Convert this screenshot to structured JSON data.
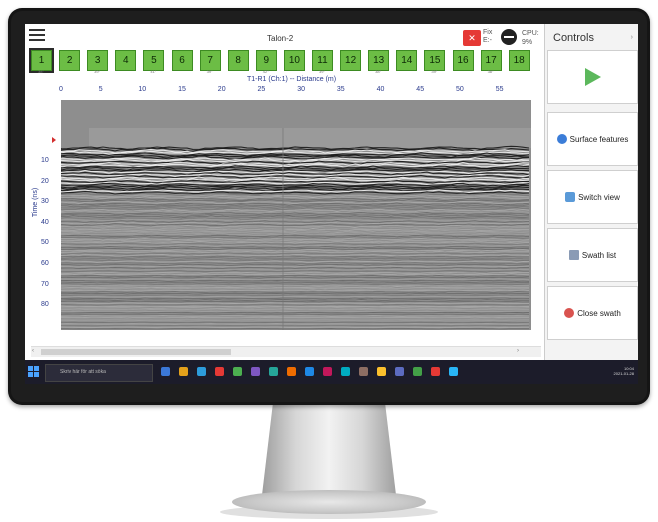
{
  "app": {
    "title": "Talon-2",
    "gps_text_line1": "Fix",
    "gps_text_line2": "E:-",
    "cpu_label": "CPU:",
    "cpu_value": "9%"
  },
  "channels": [
    {
      "num": "1",
      "sub": "38°",
      "selected": true
    },
    {
      "num": "2",
      "sub": ""
    },
    {
      "num": "3",
      "sub": "39°"
    },
    {
      "num": "4",
      "sub": ""
    },
    {
      "num": "5",
      "sub": "41°"
    },
    {
      "num": "6",
      "sub": ""
    },
    {
      "num": "7",
      "sub": "39°"
    },
    {
      "num": "8",
      "sub": ""
    },
    {
      "num": "9",
      "sub": "42°"
    },
    {
      "num": "10",
      "sub": ""
    },
    {
      "num": "11",
      "sub": "39°"
    },
    {
      "num": "12",
      "sub": ""
    },
    {
      "num": "13",
      "sub": "38°"
    },
    {
      "num": "14",
      "sub": ""
    },
    {
      "num": "15",
      "sub": "39°"
    },
    {
      "num": "16",
      "sub": ""
    },
    {
      "num": "17",
      "sub": "38°"
    },
    {
      "num": "18",
      "sub": ""
    }
  ],
  "chart": {
    "x_title": "T1-R1 (Ch:1) -- Distance (m)",
    "x_ticks": [
      "0",
      "5",
      "10",
      "15",
      "20",
      "25",
      "30",
      "35",
      "40",
      "45",
      "50",
      "55"
    ],
    "y_label": "Time (ns)",
    "y_ticks": [
      "10",
      "20",
      "30",
      "40",
      "50",
      "60",
      "70",
      "80"
    ]
  },
  "controls": {
    "title": "Controls",
    "collapse_arrow": "›",
    "buttons": [
      {
        "label": "",
        "icon": "play-icon"
      },
      {
        "label": "Surface features",
        "icon": "surface-icon"
      },
      {
        "label": "Switch view",
        "icon": "switch-view-icon"
      },
      {
        "label": "Swath list",
        "icon": "list-icon"
      },
      {
        "label": "Close swath",
        "icon": "close-icon"
      }
    ]
  },
  "taskbar": {
    "search_placeholder": "Skriv här för att söka",
    "clock": "10:04",
    "date": "2021-01-28",
    "tray": "SWE"
  },
  "colors": {
    "channel_green": "#6cbd45",
    "play_green": "#5cb85c",
    "axis_blue": "#2a3a8c",
    "gps_red": "#e53935"
  }
}
